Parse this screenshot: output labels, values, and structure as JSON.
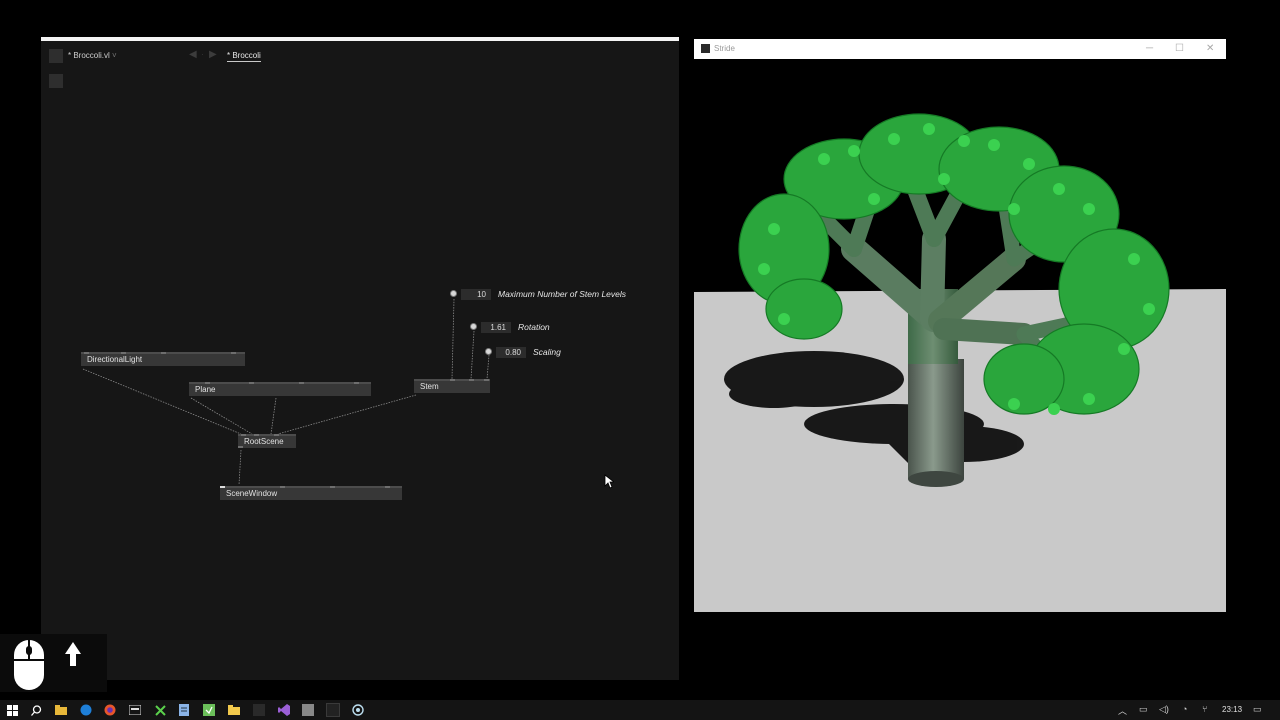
{
  "patch_editor": {
    "document_title": "* Broccoli.vl",
    "document_title_suffix": "˅",
    "breadcrumb": "* Broccoli",
    "nav_back_icon": "arrow-left-icon",
    "nav_forward_icon": "arrow-right-icon",
    "nodes": {
      "directional_light": "DirectionalLight",
      "plane": "Plane",
      "stem": "Stem",
      "root_scene": "RootScene",
      "scene_window": "SceneWindow"
    },
    "inputs": {
      "stem_levels": {
        "value": "10",
        "label": "Maximum Number of Stem Levels"
      },
      "rotation": {
        "value": "1.61",
        "label": "Rotation"
      },
      "scaling": {
        "value": "0.80",
        "label": "Scaling"
      }
    }
  },
  "render_window": {
    "title": "Stride",
    "minimize_icon": "minimize-icon",
    "maximize_icon": "maximize-icon",
    "close_icon": "close-icon",
    "colors": {
      "sky": "#000000",
      "ground": "#c8c8c8",
      "trunk": "#7a8a7c",
      "foliage": "#2aa63c"
    }
  },
  "taskbar": {
    "clock": "23:13",
    "apps": [
      "windows-start-icon",
      "search-icon",
      "file-explorer-icon",
      "edge-icon",
      "firefox-icon",
      "calculator-icon",
      "x-tool-icon",
      "notes-icon",
      "vvvv-icon",
      "folder-icon",
      "app-square-icon",
      "visual-studio-icon",
      "app-gray-icon",
      "vvvv-gamma-icon",
      "stride-icon"
    ]
  }
}
